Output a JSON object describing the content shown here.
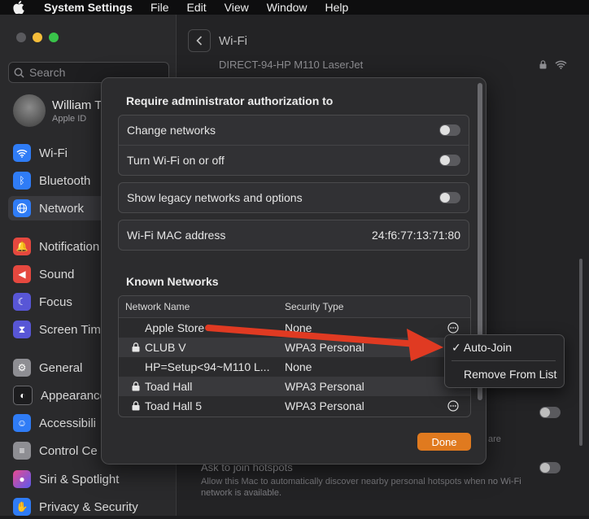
{
  "menubar": {
    "app_name": "System Settings",
    "items": [
      "File",
      "Edit",
      "View",
      "Window",
      "Help"
    ]
  },
  "sidebar": {
    "search_placeholder": "Search",
    "account_name": "William T",
    "account_sub": "Apple ID",
    "items": [
      {
        "label": "Wi-Fi",
        "icon": "wifi-icon",
        "color": "#2f7cf6"
      },
      {
        "label": "Bluetooth",
        "icon": "bluetooth-icon",
        "color": "#2f7cf6"
      },
      {
        "label": "Network",
        "icon": "globe-icon",
        "color": "#2f7cf6"
      },
      {
        "label": "Notification",
        "icon": "bell-icon",
        "color": "#e5483f"
      },
      {
        "label": "Sound",
        "icon": "speaker-icon",
        "color": "#e5483f"
      },
      {
        "label": "Focus",
        "icon": "moon-icon",
        "color": "#5856d6"
      },
      {
        "label": "Screen Tim",
        "icon": "hourglass-icon",
        "color": "#5856d6"
      },
      {
        "label": "General",
        "icon": "gear-icon",
        "color": "#8e8e93"
      },
      {
        "label": "Appearance",
        "icon": "appearance-icon",
        "color": "#1c1c1e"
      },
      {
        "label": "Accessibili",
        "icon": "accessibility-icon",
        "color": "#2f7cf6"
      },
      {
        "label": "Control Ce",
        "icon": "control-center-icon",
        "color": "#8e8e93"
      },
      {
        "label": "Siri & Spotlight",
        "icon": "siri-icon",
        "color": "#a34fd8"
      },
      {
        "label": "Privacy & Security",
        "icon": "hand-icon",
        "color": "#2f7cf6"
      }
    ]
  },
  "main": {
    "title": "Wi-Fi",
    "visible_network": "DIRECT-94-HP M110 LaserJet",
    "hotspot_title": "Ask to join hotspots",
    "hotspot_desc": "Allow this Mac to automatically discover nearby personal hotspots when no Wi-Fi network is available.",
    "partial_text": "are"
  },
  "dialog": {
    "admin_title": "Require administrator authorization to",
    "admin_rows": [
      "Change networks",
      "Turn Wi-Fi on or off"
    ],
    "legacy_row": "Show legacy networks and options",
    "mac_label": "Wi-Fi MAC address",
    "mac_value": "24:f6:77:13:71:80",
    "known_title": "Known Networks",
    "columns": [
      "Network Name",
      "Security Type"
    ],
    "networks": [
      {
        "name": "Apple Store",
        "security": "None",
        "locked": false
      },
      {
        "name": "CLUB V",
        "security": "WPA3 Personal",
        "locked": true
      },
      {
        "name": "HP=Setup<94~M110 L...",
        "security": "None",
        "locked": false
      },
      {
        "name": "Toad Hall",
        "security": "WPA3 Personal",
        "locked": true
      },
      {
        "name": "Toad Hall 5",
        "security": "WPA3 Personal",
        "locked": true
      }
    ],
    "done_label": "Done"
  },
  "context_menu": {
    "items": [
      {
        "label": "Auto-Join",
        "checked": true
      },
      {
        "label": "Remove From List",
        "checked": false
      }
    ]
  }
}
